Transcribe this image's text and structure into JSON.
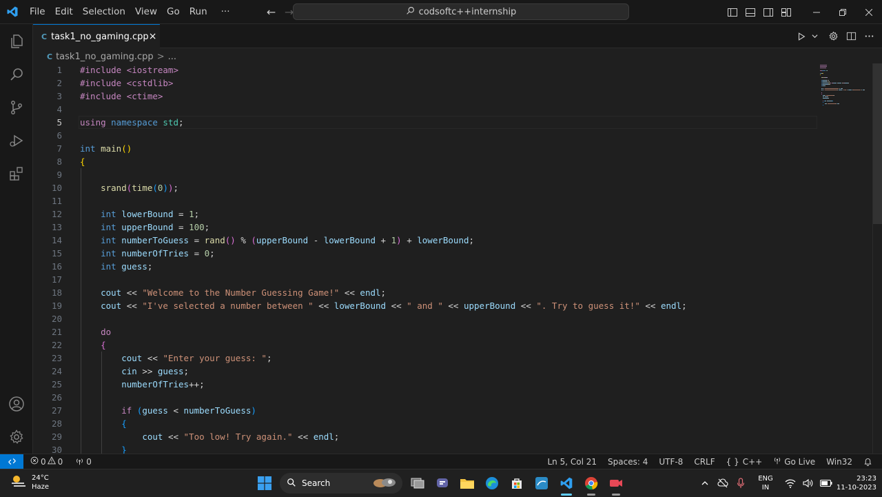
{
  "colors": {
    "accent": "#0078d4",
    "editor_bg": "#1f1f1f",
    "chrome_bg": "#181818",
    "taskbar_bg": "#202020"
  },
  "titlebar": {
    "menu": [
      "File",
      "Edit",
      "Selection",
      "View",
      "Go",
      "Run"
    ],
    "more": "···",
    "search_text": "codsoftc++internship"
  },
  "tab": {
    "label": "task1_no_gaming.cpp",
    "icon": "C",
    "close": "×"
  },
  "breadcrumb": {
    "file": "task1_no_gaming.cpp",
    "sep": ">",
    "more": "..."
  },
  "editor": {
    "active_line": 5,
    "lines": [
      {
        "n": "1",
        "code": [
          [
            "#include <iostream>",
            "pre"
          ]
        ]
      },
      {
        "n": "2",
        "code": [
          [
            "#include <cstdlib>",
            "pre"
          ]
        ]
      },
      {
        "n": "3",
        "code": [
          [
            "#include <ctime>",
            "pre"
          ]
        ]
      },
      {
        "n": "4",
        "code": []
      },
      {
        "n": "5",
        "code": [
          [
            "using ",
            "ctl"
          ],
          [
            "namespace ",
            "kw"
          ],
          [
            "std",
            "ns"
          ],
          [
            ";",
            "op"
          ]
        ]
      },
      {
        "n": "6",
        "code": []
      },
      {
        "n": "7",
        "code": [
          [
            "int ",
            "kw"
          ],
          [
            "main",
            "fn"
          ],
          [
            "()",
            "b1"
          ]
        ]
      },
      {
        "n": "8",
        "code": [
          [
            "{",
            "b1"
          ]
        ]
      },
      {
        "n": "9",
        "code": []
      },
      {
        "n": "10",
        "code": [
          [
            "    ",
            "op"
          ],
          [
            "srand",
            "fn"
          ],
          [
            "(",
            "b2"
          ],
          [
            "time",
            "fn"
          ],
          [
            "(",
            "b3"
          ],
          [
            "0",
            "num"
          ],
          [
            ")",
            "b3"
          ],
          [
            ")",
            "b2"
          ],
          [
            ";",
            "op"
          ]
        ]
      },
      {
        "n": "11",
        "code": []
      },
      {
        "n": "12",
        "code": [
          [
            "    ",
            "op"
          ],
          [
            "int ",
            "kw"
          ],
          [
            "lowerBound",
            "var"
          ],
          [
            " = ",
            "op"
          ],
          [
            "1",
            "num"
          ],
          [
            ";",
            "op"
          ]
        ]
      },
      {
        "n": "13",
        "code": [
          [
            "    ",
            "op"
          ],
          [
            "int ",
            "kw"
          ],
          [
            "upperBound",
            "var"
          ],
          [
            " = ",
            "op"
          ],
          [
            "100",
            "num"
          ],
          [
            ";",
            "op"
          ]
        ]
      },
      {
        "n": "14",
        "code": [
          [
            "    ",
            "op"
          ],
          [
            "int ",
            "kw"
          ],
          [
            "numberToGuess",
            "var"
          ],
          [
            " = ",
            "op"
          ],
          [
            "rand",
            "fn"
          ],
          [
            "()",
            "b2"
          ],
          [
            " % ",
            "op"
          ],
          [
            "(",
            "b2"
          ],
          [
            "upperBound",
            "var"
          ],
          [
            " - ",
            "op"
          ],
          [
            "lowerBound",
            "var"
          ],
          [
            " + ",
            "op"
          ],
          [
            "1",
            "num"
          ],
          [
            ")",
            "b2"
          ],
          [
            " + ",
            "op"
          ],
          [
            "lowerBound",
            "var"
          ],
          [
            ";",
            "op"
          ]
        ]
      },
      {
        "n": "15",
        "code": [
          [
            "    ",
            "op"
          ],
          [
            "int ",
            "kw"
          ],
          [
            "numberOfTries",
            "var"
          ],
          [
            " = ",
            "op"
          ],
          [
            "0",
            "num"
          ],
          [
            ";",
            "op"
          ]
        ]
      },
      {
        "n": "16",
        "code": [
          [
            "    ",
            "op"
          ],
          [
            "int ",
            "kw"
          ],
          [
            "guess",
            "var"
          ],
          [
            ";",
            "op"
          ]
        ]
      },
      {
        "n": "17",
        "code": []
      },
      {
        "n": "18",
        "code": [
          [
            "    ",
            "op"
          ],
          [
            "cout",
            "var"
          ],
          [
            " << ",
            "op"
          ],
          [
            "\"Welcome to the Number Guessing Game!\"",
            "str"
          ],
          [
            " << ",
            "op"
          ],
          [
            "endl",
            "var"
          ],
          [
            ";",
            "op"
          ]
        ]
      },
      {
        "n": "19",
        "code": [
          [
            "    ",
            "op"
          ],
          [
            "cout",
            "var"
          ],
          [
            " << ",
            "op"
          ],
          [
            "\"I've selected a number between \"",
            "str"
          ],
          [
            " << ",
            "op"
          ],
          [
            "lowerBound",
            "var"
          ],
          [
            " << ",
            "op"
          ],
          [
            "\" and \"",
            "str"
          ],
          [
            " << ",
            "op"
          ],
          [
            "upperBound",
            "var"
          ],
          [
            " << ",
            "op"
          ],
          [
            "\". Try to guess it!\"",
            "str"
          ],
          [
            " << ",
            "op"
          ],
          [
            "endl",
            "var"
          ],
          [
            ";",
            "op"
          ]
        ]
      },
      {
        "n": "20",
        "code": []
      },
      {
        "n": "21",
        "code": [
          [
            "    ",
            "op"
          ],
          [
            "do",
            "ctl"
          ]
        ]
      },
      {
        "n": "22",
        "code": [
          [
            "    ",
            "op"
          ],
          [
            "{",
            "b2"
          ]
        ]
      },
      {
        "n": "23",
        "code": [
          [
            "        ",
            "op"
          ],
          [
            "cout",
            "var"
          ],
          [
            " << ",
            "op"
          ],
          [
            "\"Enter your guess: \"",
            "str"
          ],
          [
            ";",
            "op"
          ]
        ]
      },
      {
        "n": "24",
        "code": [
          [
            "        ",
            "op"
          ],
          [
            "cin",
            "var"
          ],
          [
            " >> ",
            "op"
          ],
          [
            "guess",
            "var"
          ],
          [
            ";",
            "op"
          ]
        ]
      },
      {
        "n": "25",
        "code": [
          [
            "        ",
            "op"
          ],
          [
            "numberOfTries",
            "var"
          ],
          [
            "++;",
            "op"
          ]
        ]
      },
      {
        "n": "26",
        "code": []
      },
      {
        "n": "27",
        "code": [
          [
            "        ",
            "op"
          ],
          [
            "if ",
            "ctl"
          ],
          [
            "(",
            "b3"
          ],
          [
            "guess",
            "var"
          ],
          [
            " < ",
            "op"
          ],
          [
            "numberToGuess",
            "var"
          ],
          [
            ")",
            "b3"
          ]
        ]
      },
      {
        "n": "28",
        "code": [
          [
            "        ",
            "op"
          ],
          [
            "{",
            "b3"
          ]
        ]
      },
      {
        "n": "29",
        "code": [
          [
            "            ",
            "op"
          ],
          [
            "cout",
            "var"
          ],
          [
            " << ",
            "op"
          ],
          [
            "\"Too low! Try again.\"",
            "str"
          ],
          [
            " << ",
            "op"
          ],
          [
            "endl",
            "var"
          ],
          [
            ";",
            "op"
          ]
        ]
      },
      {
        "n": "30",
        "code": [
          [
            "        ",
            "op"
          ],
          [
            "}",
            "b3"
          ]
        ]
      }
    ]
  },
  "statusbar": {
    "errors": "0",
    "warnings": "0",
    "ports": "0",
    "position": "Ln 5, Col 21",
    "spaces": "Spaces: 4",
    "encoding": "UTF-8",
    "eol": "CRLF",
    "language": "C++",
    "golive": "Go Live",
    "platform": "Win32"
  },
  "taskbar": {
    "weather_temp": "24°C",
    "weather_desc": "Haze",
    "search_label": "Search",
    "lang_top": "ENG",
    "lang_bottom": "IN",
    "time": "23:23",
    "date": "11-10-2023"
  }
}
